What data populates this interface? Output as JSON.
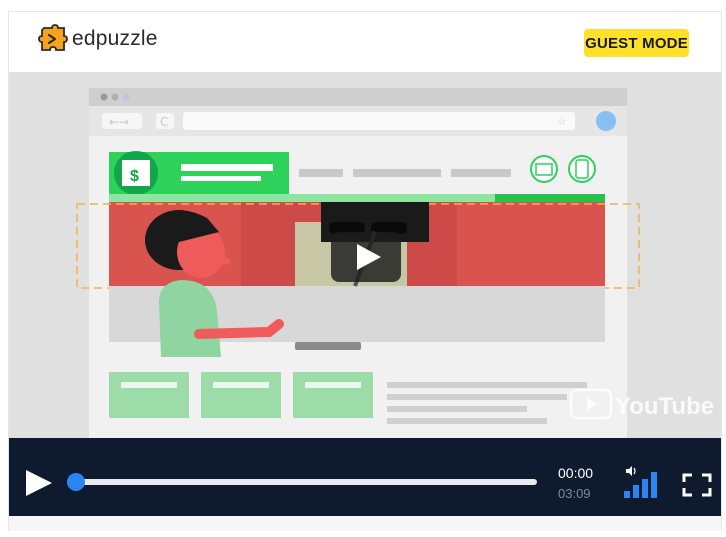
{
  "app": {
    "logo_text": "edpuzzle",
    "guest_badge": "GUEST MODE"
  },
  "video": {
    "watermark_text": "YouTube",
    "bank_glyph": "$",
    "play_icon": "play-circle-icon"
  },
  "controls": {
    "current_time": "00:00",
    "duration": "03:09",
    "progress": 0.0,
    "icons": [
      "play-icon",
      "volume-icon",
      "fullscreen-icon"
    ]
  },
  "colors": {
    "badge": "#ffe12b",
    "controls_bg": "#0e1a2e",
    "accent": "#2a84f2",
    "video_green": "#27c24c",
    "video_red": "#d9534f"
  }
}
